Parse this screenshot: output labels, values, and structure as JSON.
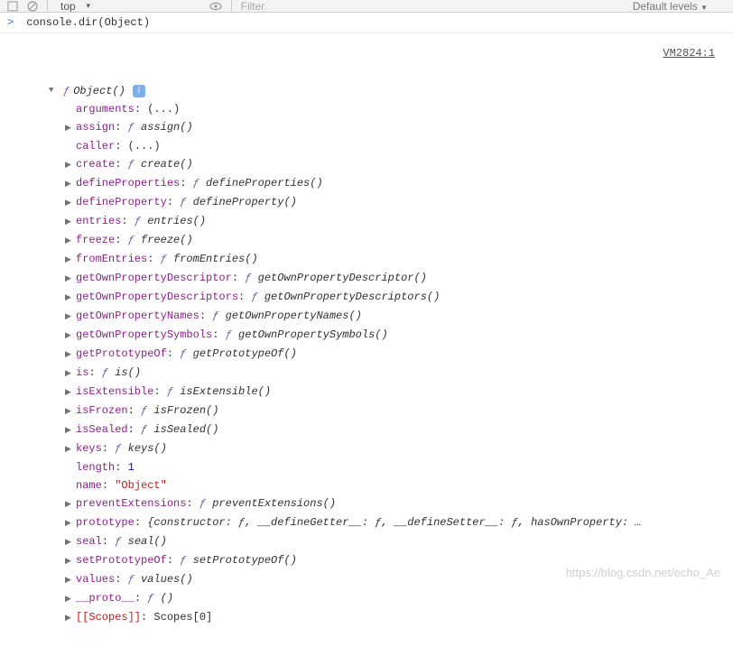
{
  "toolbar": {
    "context": "top",
    "filter_placeholder": "Filter",
    "levels": "Default levels"
  },
  "console": {
    "prompt": ">",
    "command": "console.dir(Object)",
    "source_link": "VM2824:1"
  },
  "tree_header": {
    "f": "ƒ",
    "sig": "Object()"
  },
  "props": [
    {
      "arrow": "",
      "key": "arguments",
      "sep": ": ",
      "val_plain": "(...)"
    },
    {
      "arrow": "▶",
      "key": "assign",
      "sep": ": ",
      "f": "ƒ ",
      "sig": "assign()"
    },
    {
      "arrow": "",
      "key": "caller",
      "sep": ": ",
      "val_plain": "(...)"
    },
    {
      "arrow": "▶",
      "key": "create",
      "sep": ": ",
      "f": "ƒ ",
      "sig": "create()"
    },
    {
      "arrow": "▶",
      "key": "defineProperties",
      "sep": ": ",
      "f": "ƒ ",
      "sig": "defineProperties()"
    },
    {
      "arrow": "▶",
      "key": "defineProperty",
      "sep": ": ",
      "f": "ƒ ",
      "sig": "defineProperty()"
    },
    {
      "arrow": "▶",
      "key": "entries",
      "sep": ": ",
      "f": "ƒ ",
      "sig": "entries()"
    },
    {
      "arrow": "▶",
      "key": "freeze",
      "sep": ": ",
      "f": "ƒ ",
      "sig": "freeze()"
    },
    {
      "arrow": "▶",
      "key": "fromEntries",
      "sep": ": ",
      "f": "ƒ ",
      "sig": "fromEntries()"
    },
    {
      "arrow": "▶",
      "key": "getOwnPropertyDescriptor",
      "sep": ": ",
      "f": "ƒ ",
      "sig": "getOwnPropertyDescriptor()"
    },
    {
      "arrow": "▶",
      "key": "getOwnPropertyDescriptors",
      "sep": ": ",
      "f": "ƒ ",
      "sig": "getOwnPropertyDescriptors()"
    },
    {
      "arrow": "▶",
      "key": "getOwnPropertyNames",
      "sep": ": ",
      "f": "ƒ ",
      "sig": "getOwnPropertyNames()"
    },
    {
      "arrow": "▶",
      "key": "getOwnPropertySymbols",
      "sep": ": ",
      "f": "ƒ ",
      "sig": "getOwnPropertySymbols()"
    },
    {
      "arrow": "▶",
      "key": "getPrototypeOf",
      "sep": ": ",
      "f": "ƒ ",
      "sig": "getPrototypeOf()"
    },
    {
      "arrow": "▶",
      "key": "is",
      "sep": ": ",
      "f": "ƒ ",
      "sig": "is()"
    },
    {
      "arrow": "▶",
      "key": "isExtensible",
      "sep": ": ",
      "f": "ƒ ",
      "sig": "isExtensible()"
    },
    {
      "arrow": "▶",
      "key": "isFrozen",
      "sep": ": ",
      "f": "ƒ ",
      "sig": "isFrozen()"
    },
    {
      "arrow": "▶",
      "key": "isSealed",
      "sep": ": ",
      "f": "ƒ ",
      "sig": "isSealed()"
    },
    {
      "arrow": "▶",
      "key": "keys",
      "sep": ": ",
      "f": "ƒ ",
      "sig": "keys()"
    },
    {
      "arrow": "",
      "key": "length",
      "sep": ": ",
      "val_num": "1"
    },
    {
      "arrow": "",
      "key": "name",
      "sep": ": ",
      "val_str": "\"Object\""
    },
    {
      "arrow": "▶",
      "key": "preventExtensions",
      "sep": ": ",
      "f": "ƒ ",
      "sig": "preventExtensions()"
    },
    {
      "arrow": "▶",
      "key": "prototype",
      "sep": ": ",
      "val_obj": "{constructor: ƒ, __defineGetter__: ƒ, __defineSetter__: ƒ, hasOwnProperty: …"
    },
    {
      "arrow": "▶",
      "key": "seal",
      "sep": ": ",
      "f": "ƒ ",
      "sig": "seal()"
    },
    {
      "arrow": "▶",
      "key": "setPrototypeOf",
      "sep": ": ",
      "f": "ƒ ",
      "sig": "setPrototypeOf()"
    },
    {
      "arrow": "▶",
      "key": "values",
      "sep": ": ",
      "f": "ƒ ",
      "sig": "values()"
    },
    {
      "arrow": "▶",
      "key": "__proto__",
      "sep": ": ",
      "f": "ƒ ",
      "sig": "()"
    },
    {
      "arrow": "▶",
      "key_sys": "[[Scopes]]",
      "sep": ": ",
      "val_plain": "Scopes[0]"
    }
  ],
  "watermark": "https://blog.csdn.net/echo_Ae"
}
